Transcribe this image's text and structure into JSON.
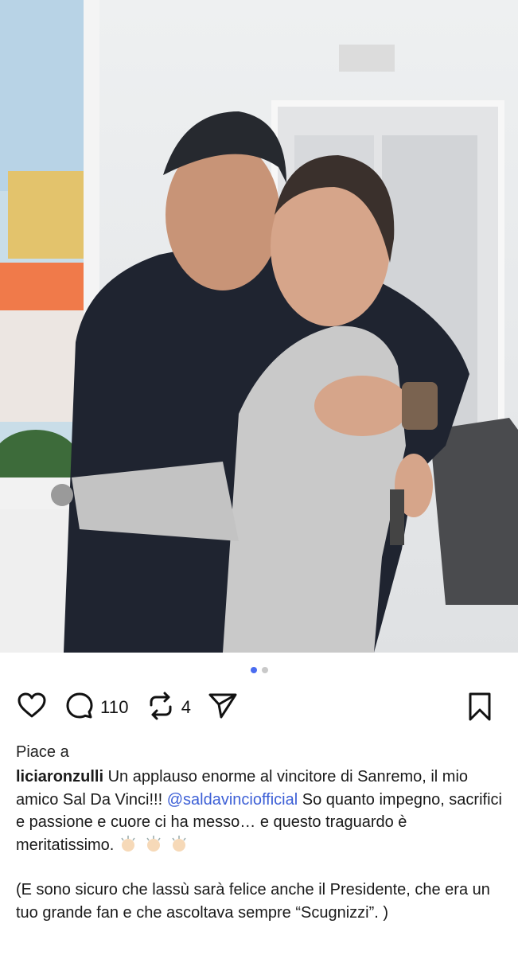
{
  "post": {
    "carousel": {
      "count": 2,
      "active_index": 0
    },
    "actions": {
      "comments_count": "110",
      "reposts_count": "4"
    },
    "liked_by_prefix": "Piace a",
    "caption": {
      "username": "liciaronzulli",
      "line1": " Un applauso enorme al vincitore di Sanremo, il  mio amico Sal Da Vinci!!! ",
      "mention": "@saldavinciofficial",
      "line2": " So quanto impegno, sacrifici e passione e cuore ci ha messo… e questo traguardo è meritatissimo.",
      "line3": "(E sono sicuro che lassù sarà felice anche il Presidente, che era un tuo grande fan e che ascoltava sempre “Scugnizzi”. )"
    },
    "icons": {
      "like": "heart-icon",
      "comment": "comment-bubble-icon",
      "repost": "repost-icon",
      "share": "send-icon",
      "save": "bookmark-icon",
      "clap": "clapping-hands-icon"
    },
    "colors": {
      "accent": "#4a6cf0",
      "mention": "#3c5fd6",
      "inactive_dot": "#c9c9c9"
    }
  }
}
